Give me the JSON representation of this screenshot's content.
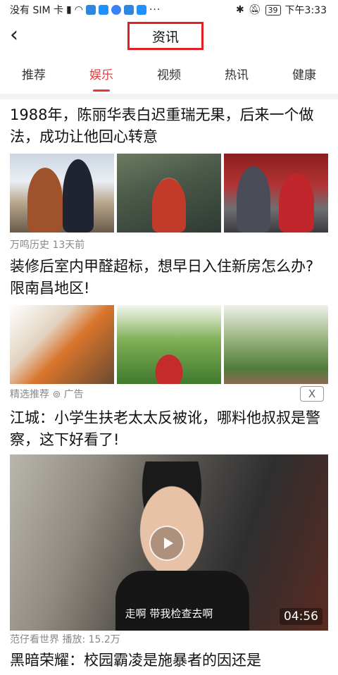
{
  "status_bar": {
    "carrier": "没有 SIM 卡",
    "time": "下午3:33",
    "battery": "39"
  },
  "header": {
    "back_icon": "‹",
    "title": "资讯"
  },
  "tabs": [
    {
      "label": "推荐"
    },
    {
      "label": "娱乐"
    },
    {
      "label": "视频"
    },
    {
      "label": "热讯"
    },
    {
      "label": "健康"
    }
  ],
  "active_tab": "娱乐",
  "feed": {
    "article1": {
      "title": "1988年，陈丽华表白迟重瑞无果，后来一个做法，成功让他回心转意",
      "meta": "万鸣历史 13天前"
    },
    "article2": {
      "title": "装修后室内甲醛超标，想早日入住新房怎么办?限南昌地区!",
      "ad_meta": "精选推荐 ⊚ 广告",
      "close": "X"
    },
    "article3": {
      "title": "江城：小学生扶老太太反被讹，哪料他叔叔是警察，这下好看了!",
      "video_subtitle": "走啊 带我检查去啊",
      "duration": "04:56",
      "meta": "范仔看世界 播放: 15.2万"
    },
    "article4": {
      "title": "黑暗荣耀：校园霸凌是施暴者的因还是"
    }
  },
  "colors": {
    "accent": "#e13a3a",
    "title_box_border": "#e12128"
  }
}
